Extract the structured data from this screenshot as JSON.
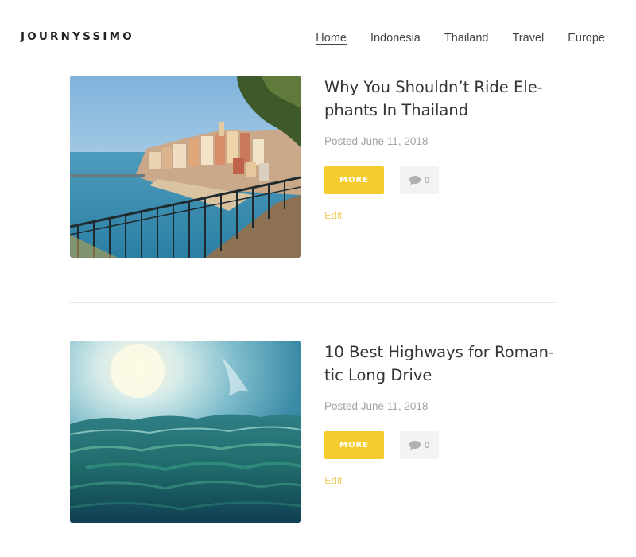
{
  "site": {
    "logo": "JOURNYSSIMO"
  },
  "nav": {
    "items": [
      {
        "label": "Home",
        "active": true
      },
      {
        "label": "Indonesia"
      },
      {
        "label": "Thailand"
      },
      {
        "label": "Travel"
      },
      {
        "label": "Europe"
      }
    ]
  },
  "posts": [
    {
      "title": "Why You Shouldn’t Ride Ele- phants In Thailand",
      "date": "Posted June 11, 2018",
      "more_label": "MORE",
      "comment_count": "0",
      "edit_label": "Edit",
      "image": "coastal-village-icon"
    },
    {
      "title": "10 Best Highways for Roman- tic Long Drive",
      "date": "Posted June 11, 2018",
      "more_label": "MORE",
      "comment_count": "0",
      "edit_label": "Edit",
      "image": "ocean-wave-icon"
    }
  ],
  "colors": {
    "accent": "#f6cb2d",
    "edit_link": "#f1cf6a",
    "muted_text": "#a2a2a2",
    "comment_bg": "#f3f3f3"
  }
}
